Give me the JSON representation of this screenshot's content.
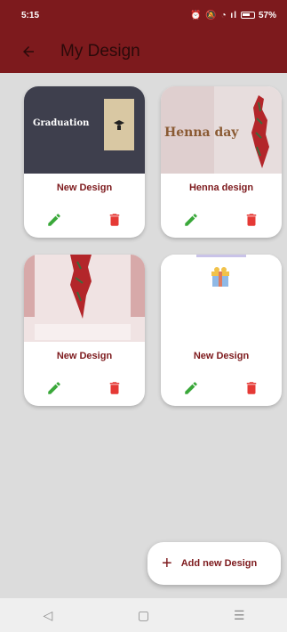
{
  "status_bar": {
    "time": "5:15",
    "icons": "⏰ 🔕 ◔ ıl",
    "battery": "57%"
  },
  "app_bar": {
    "title": "My Design"
  },
  "cards": [
    {
      "title": "New Design",
      "thumbnail_text": "Graduation",
      "thumbnail": "graduation"
    },
    {
      "title": "Henna design",
      "thumbnail_text": "Henna day",
      "thumbnail": "henna"
    },
    {
      "title": "New Design",
      "thumbnail": "map"
    },
    {
      "title": "New Design",
      "thumbnail": "gift"
    }
  ],
  "fab": {
    "label": "Add new Design"
  },
  "colors": {
    "primary": "#7d1a1d",
    "edit": "#3aa83a",
    "delete": "#e53935"
  },
  "icons": {
    "edit": "pencil-icon",
    "delete": "trash-icon",
    "add": "plus-icon",
    "back": "back-arrow-icon"
  }
}
